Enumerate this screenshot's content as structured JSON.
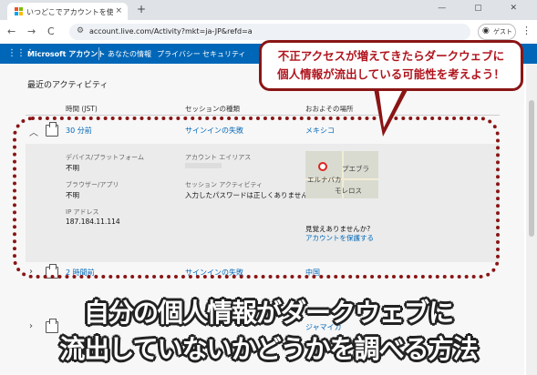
{
  "browser": {
    "tab_title": "いつどこでアカウントを使ったかご確認",
    "tab_close": "×",
    "new_tab": "+",
    "address": "account.live.com/Activity?mkt=ja-JP&refd=a",
    "profile_label": "ゲスト",
    "back": "←",
    "forward": "→",
    "reload": "C",
    "window_controls": "— ▢ ✕"
  },
  "ms_nav": {
    "brand": "Microsoft アカウント",
    "items": [
      "あなたの情報",
      "プライバシー",
      "セキュリティ"
    ]
  },
  "activity": {
    "section_title": "最近のアクティビティ",
    "headers": [
      "時間 (JST)",
      "セッションの種類",
      "おおよその場所"
    ],
    "rows": [
      {
        "time": "30 分前",
        "type": "サインインの失敗",
        "place": "メキシコ"
      },
      {
        "time": "2 時間前",
        "type": "サインインの失敗",
        "place": "中国"
      },
      {
        "time": "",
        "type": "",
        "place": "ジャマイカ"
      }
    ],
    "detail": {
      "device_label": "デバイス/プラットフォーム",
      "device_value": "不明",
      "browser_label": "ブラウザー/アプリ",
      "browser_value": "不明",
      "ip_label": "IP アドレス",
      "ip_value": "187.184.11.114",
      "alias_label": "アカウント エイリアス",
      "session_label": "セッション アクティビティ",
      "session_value": "入力したパスワードは正しくありません",
      "map_labels": [
        "プエブラ",
        "エルナバカ",
        "モレロス"
      ],
      "not_recognized": "見覚えありませんか?",
      "protect_link": "アカウントを保護する"
    }
  },
  "callout": {
    "line1": "不正アクセスが増えてきたらダークウェブに",
    "line2": "個人情報が流出している可能性を考えよう！"
  },
  "caption": {
    "line1": "自分の個人情報がダークウェブに",
    "line2": "流出していないかどうかを調べる方法"
  },
  "colors": {
    "accent": "#0067b8",
    "callout_border": "#8a1515",
    "callout_text": "#b0141d"
  }
}
